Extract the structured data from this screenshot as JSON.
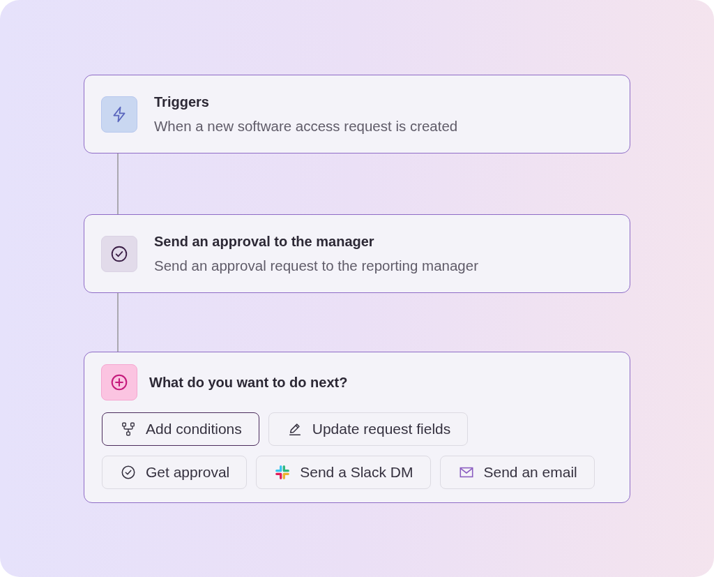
{
  "steps": [
    {
      "kind": "trigger",
      "title": "Triggers",
      "description": "When a new software access request is created"
    },
    {
      "kind": "approval",
      "title": "Send an approval to the manager",
      "description": "Send an approval request to the reporting manager"
    }
  ],
  "next_step": {
    "kind": "add",
    "title": "What do you want to do next?",
    "options": [
      {
        "kind": "conditions",
        "label": "Add conditions",
        "selected": true
      },
      {
        "kind": "edit",
        "label": "Update request fields",
        "selected": false
      },
      {
        "kind": "approval",
        "label": "Get approval",
        "selected": false
      },
      {
        "kind": "chat",
        "label": "Send a Slack DM",
        "selected": false
      },
      {
        "kind": "email",
        "label": "Send an email",
        "selected": false
      }
    ]
  }
}
